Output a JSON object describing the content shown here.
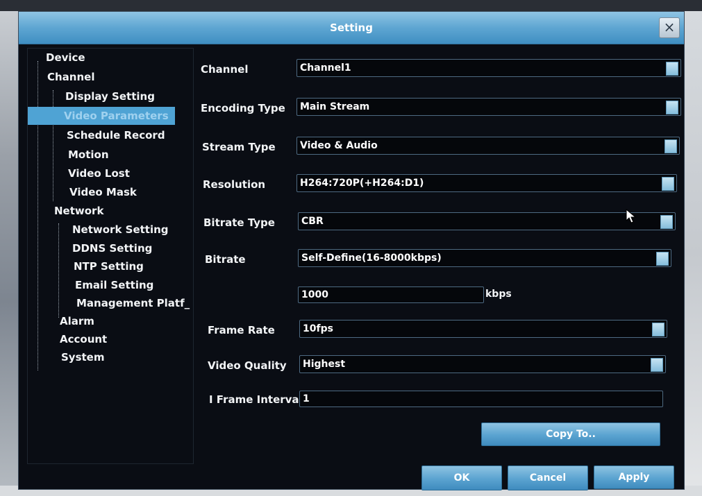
{
  "window": {
    "title": "Setting",
    "close_glyph": "×"
  },
  "tree": {
    "items": [
      {
        "label": "Device"
      },
      {
        "label": "Channel"
      },
      {
        "label": "Display Setting"
      },
      {
        "label": "Video Parameters",
        "selected": true
      },
      {
        "label": "Schedule Record"
      },
      {
        "label": "Motion"
      },
      {
        "label": "Video Lost"
      },
      {
        "label": "Video Mask"
      },
      {
        "label": "Network"
      },
      {
        "label": "Network Setting"
      },
      {
        "label": "DDNS Setting"
      },
      {
        "label": "NTP Setting"
      },
      {
        "label": "Email Setting"
      },
      {
        "label": "Management Platf_"
      },
      {
        "label": "Alarm"
      },
      {
        "label": "Account"
      },
      {
        "label": "System"
      }
    ]
  },
  "form": {
    "channel": {
      "label": "Channel",
      "value": "Channel1"
    },
    "encoding_type": {
      "label": "Encoding Type",
      "value": "Main Stream"
    },
    "stream_type": {
      "label": "Stream Type",
      "value": "Video & Audio"
    },
    "resolution": {
      "label": "Resolution",
      "value": "H264:720P(+H264:D1)"
    },
    "bitrate_type": {
      "label": "Bitrate Type",
      "value": "CBR"
    },
    "bitrate": {
      "label": "Bitrate",
      "value": "Self-Define(16-8000kbps)"
    },
    "bitrate_custom": {
      "value": "1000",
      "unit": "kbps"
    },
    "frame_rate": {
      "label": "Frame Rate",
      "value": "10fps"
    },
    "video_quality": {
      "label": "Video Quality",
      "value": "Highest"
    },
    "i_frame_interval": {
      "label": "I Frame Interval",
      "value": "1"
    }
  },
  "buttons": {
    "copy_to": "Copy To..",
    "ok": "OK",
    "cancel": "Cancel",
    "apply": "Apply"
  },
  "icons": {
    "dropdown": "chevron-down-icon",
    "close": "close-icon",
    "cursor": "mouse-pointer-icon"
  },
  "colors": {
    "accent": "#4fa3d4",
    "title_bar": "#5ea6d2",
    "panel_bg": "#0a0d14"
  }
}
